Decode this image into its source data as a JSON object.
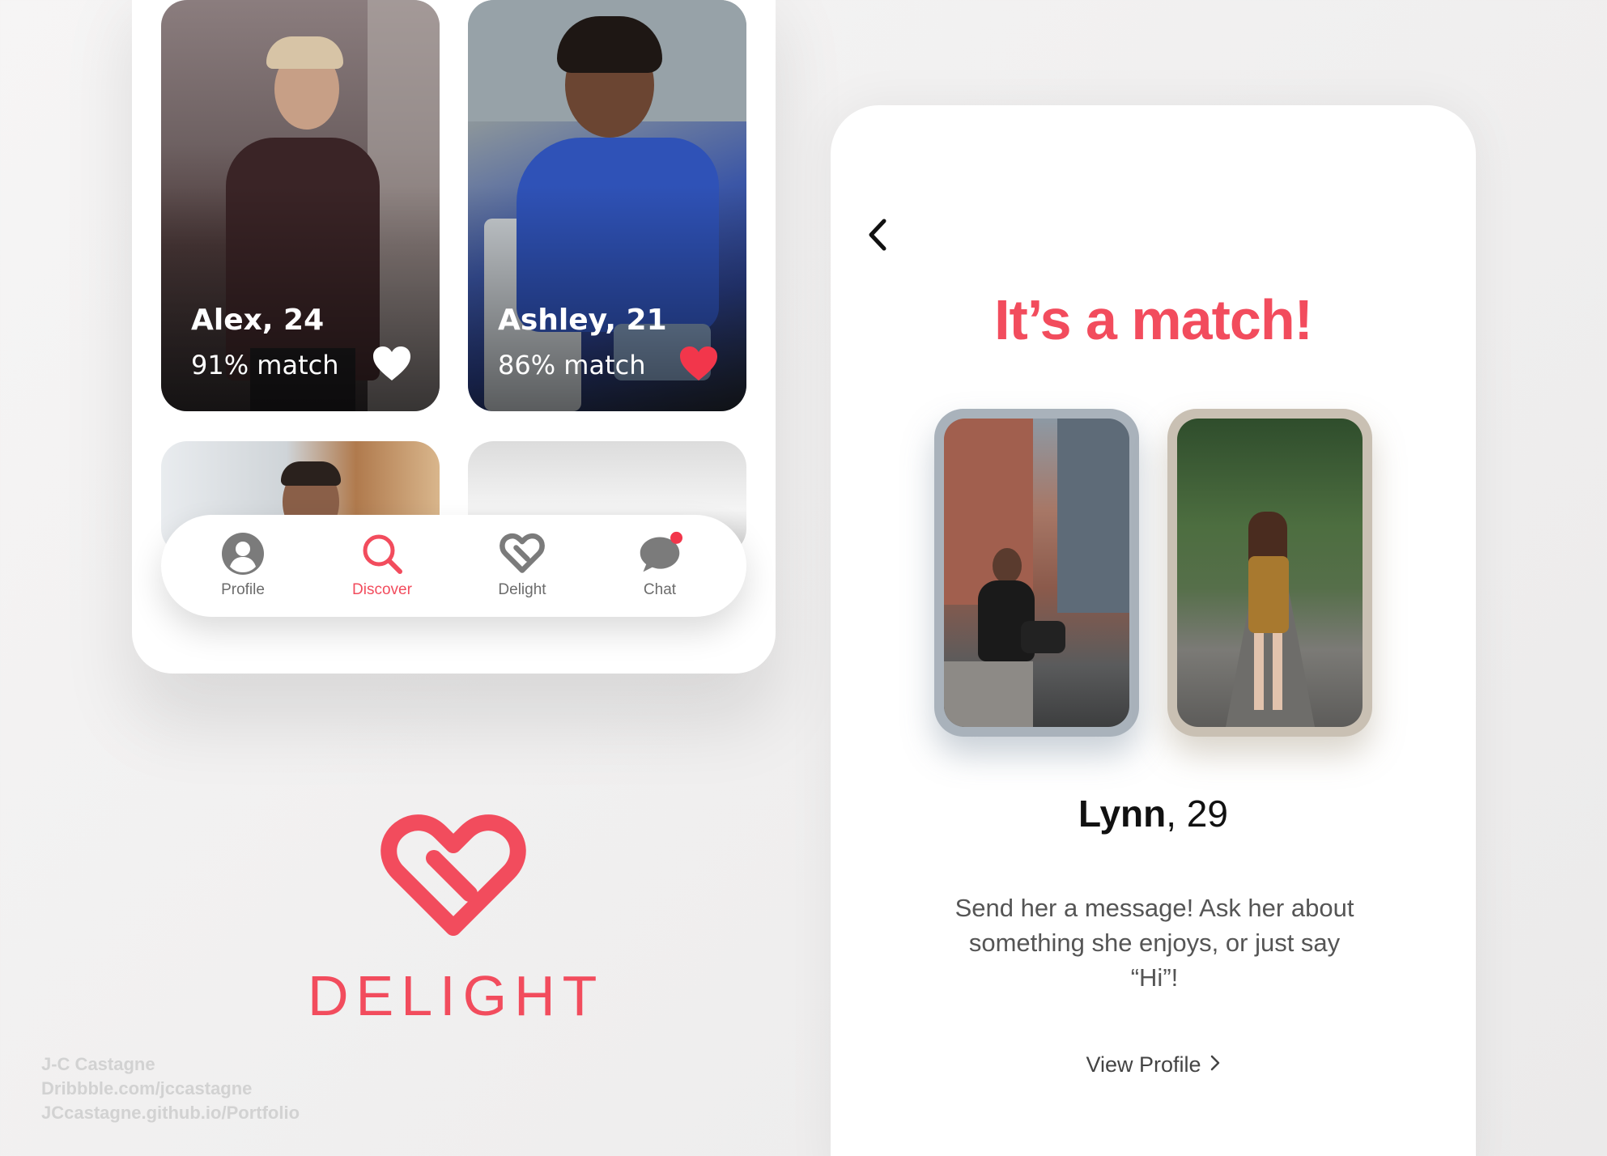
{
  "discover": {
    "cards": [
      {
        "name": "Alex, 24",
        "match": "91% match",
        "liked": false
      },
      {
        "name": "Ashley, 21",
        "match": "86% match",
        "liked": true
      }
    ],
    "tabbar": {
      "items": [
        {
          "label": "Profile",
          "icon": "profile-icon",
          "active": false
        },
        {
          "label": "Discover",
          "icon": "search-icon",
          "active": true
        },
        {
          "label": "Delight",
          "icon": "delight-heart-icon",
          "active": false
        },
        {
          "label": "Chat",
          "icon": "chat-icon",
          "active": false,
          "badge": true
        }
      ]
    }
  },
  "brand": {
    "name": "DELIGHT",
    "color": "#f24c5d"
  },
  "credits": {
    "author": "J-C Castagne",
    "dribbble": "Dribbble.com/jccastagne",
    "portfolio": "JCcastagne.github.io/Portfolio"
  },
  "match_screen": {
    "title": "It’s a match!",
    "person_name": "Lynn",
    "person_age": ", 29",
    "message": "Send her a message! Ask her about something she enjoys, or just say “Hi”!",
    "view_profile": "View Profile"
  },
  "colors": {
    "accent": "#f24c5d",
    "muted": "#6c6c6c"
  }
}
